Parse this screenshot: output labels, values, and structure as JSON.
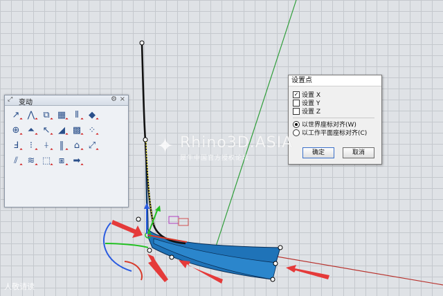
{
  "toolbar_panel": {
    "title": "变动",
    "tools": [
      {
        "name": "move-icon",
        "glyph": "↗",
        "flyout": true
      },
      {
        "name": "bend-icon",
        "glyph": "⋀",
        "flyout": true
      },
      {
        "name": "copy-icon",
        "glyph": "⧉",
        "flyout": true
      },
      {
        "name": "box-icon",
        "glyph": "▦",
        "flyout": true
      },
      {
        "name": "mirror-icon",
        "glyph": "⫴",
        "flyout": true
      },
      {
        "name": "rotate3d-icon",
        "glyph": "◆",
        "flyout": true
      },
      {
        "name": "blank-icon",
        "glyph": "",
        "flyout": false
      },
      {
        "name": "scale-icon",
        "glyph": "⊕",
        "flyout": true
      },
      {
        "name": "shear-icon",
        "glyph": "⏶",
        "flyout": true
      },
      {
        "name": "orient-icon",
        "glyph": "↖",
        "flyout": true
      },
      {
        "name": "flow-icon",
        "glyph": "◢",
        "flyout": true
      },
      {
        "name": "array-icon",
        "glyph": "▩",
        "flyout": true
      },
      {
        "name": "polar-array-icon",
        "glyph": "⁘",
        "flyout": true
      },
      {
        "name": "blank2-icon",
        "glyph": "",
        "flyout": false
      },
      {
        "name": "twist-icon",
        "glyph": "Ⅎ",
        "flyout": true
      },
      {
        "name": "align-icon",
        "glyph": "⁝",
        "flyout": true
      },
      {
        "name": "taper-icon",
        "glyph": "⍭",
        "flyout": true
      },
      {
        "name": "stretch-icon",
        "glyph": "‖",
        "flyout": true
      },
      {
        "name": "cage-icon",
        "glyph": "⌂",
        "flyout": true
      },
      {
        "name": "splop-icon",
        "glyph": "⤢",
        "flyout": true
      },
      {
        "name": "blank3-icon",
        "glyph": "",
        "flyout": false
      },
      {
        "name": "slide-icon",
        "glyph": "⫽",
        "flyout": true
      },
      {
        "name": "smooth-icon",
        "glyph": "≋",
        "flyout": true
      },
      {
        "name": "project-icon",
        "glyph": "⬚",
        "flyout": true
      },
      {
        "name": "setpt-icon",
        "glyph": "⧆",
        "flyout": true
      },
      {
        "name": "arrow-icon",
        "glyph": "➡",
        "flyout": true
      }
    ]
  },
  "dialog": {
    "title": "设置点",
    "options": [
      {
        "label": "设置 X",
        "checked": true
      },
      {
        "label": "设置 Y",
        "checked": false
      },
      {
        "label": "设置 Z",
        "checked": false
      }
    ],
    "align": [
      {
        "label": "以世界座标对齐(W)",
        "selected": true
      },
      {
        "label": "以工作平面座标对齐(C)",
        "selected": false
      }
    ],
    "ok_label": "确定",
    "cancel_label": "取消"
  },
  "watermark": {
    "brand": "Rhino3D.ASIA",
    "sub": "犀牛中国官方授权论坛"
  },
  "credit": "人敬请读"
}
